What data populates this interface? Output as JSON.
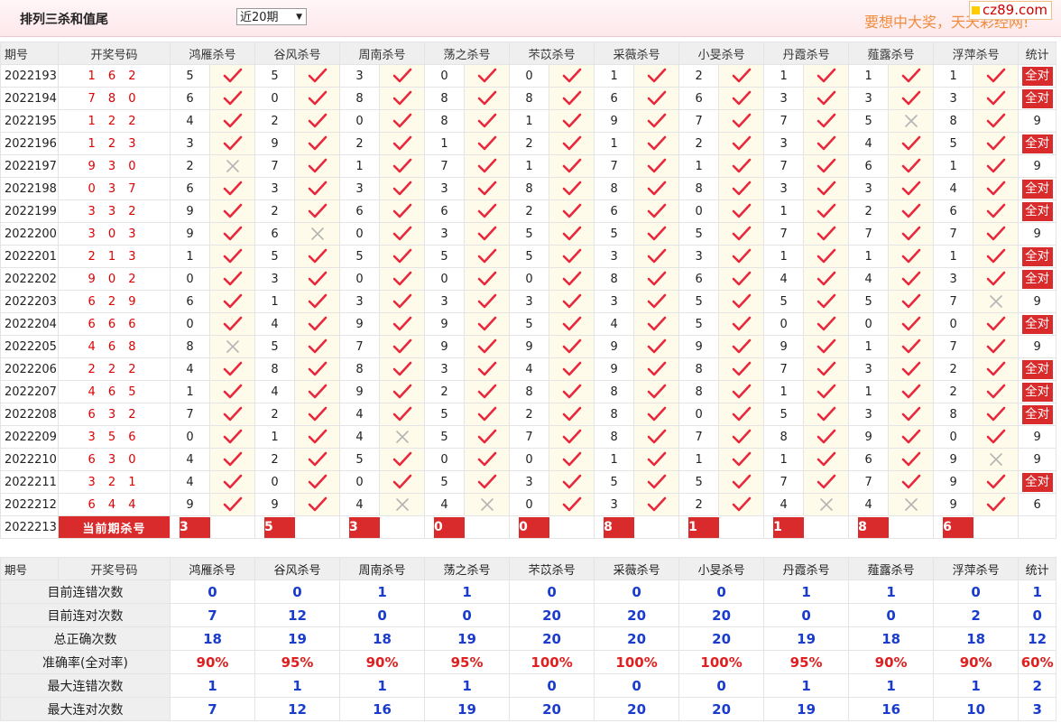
{
  "header": {
    "title": "排列三杀和值尾",
    "period_select": "近20期",
    "slogan": "要想中大奖，天天彩经网!",
    "logo": "cz89.com"
  },
  "columns": [
    "期号",
    "开奖号码",
    "鸿雁杀号",
    "谷风杀号",
    "周南杀号",
    "荡之杀号",
    "芣苡杀号",
    "采薇杀号",
    "小旻杀号",
    "丹霞杀号",
    "薤露杀号",
    "浮萍杀号",
    "统计"
  ],
  "all_correct_label": "全对",
  "rows": [
    {
      "id": "2022193",
      "draw": "1 6 2",
      "kills": [
        [
          5,
          1
        ],
        [
          5,
          1
        ],
        [
          3,
          1
        ],
        [
          0,
          1
        ],
        [
          0,
          1
        ],
        [
          1,
          1
        ],
        [
          2,
          1
        ],
        [
          1,
          1
        ],
        [
          1,
          1
        ],
        [
          1,
          1
        ]
      ],
      "stat": "全对"
    },
    {
      "id": "2022194",
      "draw": "7 8 0",
      "kills": [
        [
          6,
          1
        ],
        [
          0,
          1
        ],
        [
          8,
          1
        ],
        [
          8,
          1
        ],
        [
          8,
          1
        ],
        [
          6,
          1
        ],
        [
          6,
          1
        ],
        [
          3,
          1
        ],
        [
          3,
          1
        ],
        [
          3,
          1
        ]
      ],
      "stat": "全对"
    },
    {
      "id": "2022195",
      "draw": "1 2 2",
      "kills": [
        [
          4,
          1
        ],
        [
          2,
          1
        ],
        [
          0,
          1
        ],
        [
          8,
          1
        ],
        [
          1,
          1
        ],
        [
          9,
          1
        ],
        [
          7,
          1
        ],
        [
          7,
          1
        ],
        [
          5,
          0
        ],
        [
          8,
          1
        ]
      ],
      "stat": "9"
    },
    {
      "id": "2022196",
      "draw": "1 2 3",
      "kills": [
        [
          3,
          1
        ],
        [
          9,
          1
        ],
        [
          2,
          1
        ],
        [
          1,
          1
        ],
        [
          2,
          1
        ],
        [
          1,
          1
        ],
        [
          2,
          1
        ],
        [
          3,
          1
        ],
        [
          4,
          1
        ],
        [
          5,
          1
        ]
      ],
      "stat": "全对"
    },
    {
      "id": "2022197",
      "draw": "9 3 0",
      "kills": [
        [
          2,
          0
        ],
        [
          7,
          1
        ],
        [
          1,
          1
        ],
        [
          7,
          1
        ],
        [
          1,
          1
        ],
        [
          7,
          1
        ],
        [
          1,
          1
        ],
        [
          7,
          1
        ],
        [
          6,
          1
        ],
        [
          1,
          1
        ]
      ],
      "stat": "9"
    },
    {
      "id": "2022198",
      "draw": "0 3 7",
      "kills": [
        [
          6,
          1
        ],
        [
          3,
          1
        ],
        [
          3,
          1
        ],
        [
          3,
          1
        ],
        [
          8,
          1
        ],
        [
          8,
          1
        ],
        [
          8,
          1
        ],
        [
          3,
          1
        ],
        [
          3,
          1
        ],
        [
          4,
          1
        ]
      ],
      "stat": "全对"
    },
    {
      "id": "2022199",
      "draw": "3 3 2",
      "kills": [
        [
          9,
          1
        ],
        [
          2,
          1
        ],
        [
          6,
          1
        ],
        [
          6,
          1
        ],
        [
          2,
          1
        ],
        [
          6,
          1
        ],
        [
          0,
          1
        ],
        [
          1,
          1
        ],
        [
          2,
          1
        ],
        [
          6,
          1
        ]
      ],
      "stat": "全对"
    },
    {
      "id": "2022200",
      "draw": "3 0 3",
      "kills": [
        [
          9,
          1
        ],
        [
          6,
          0
        ],
        [
          0,
          1
        ],
        [
          3,
          1
        ],
        [
          5,
          1
        ],
        [
          5,
          1
        ],
        [
          5,
          1
        ],
        [
          7,
          1
        ],
        [
          7,
          1
        ],
        [
          7,
          1
        ]
      ],
      "stat": "9"
    },
    {
      "id": "2022201",
      "draw": "2 1 3",
      "kills": [
        [
          1,
          1
        ],
        [
          5,
          1
        ],
        [
          5,
          1
        ],
        [
          5,
          1
        ],
        [
          5,
          1
        ],
        [
          3,
          1
        ],
        [
          3,
          1
        ],
        [
          1,
          1
        ],
        [
          1,
          1
        ],
        [
          1,
          1
        ]
      ],
      "stat": "全对"
    },
    {
      "id": "2022202",
      "draw": "9 0 2",
      "kills": [
        [
          0,
          1
        ],
        [
          3,
          1
        ],
        [
          0,
          1
        ],
        [
          0,
          1
        ],
        [
          0,
          1
        ],
        [
          8,
          1
        ],
        [
          6,
          1
        ],
        [
          4,
          1
        ],
        [
          4,
          1
        ],
        [
          3,
          1
        ]
      ],
      "stat": "全对"
    },
    {
      "id": "2022203",
      "draw": "6 2 9",
      "kills": [
        [
          6,
          1
        ],
        [
          1,
          1
        ],
        [
          3,
          1
        ],
        [
          3,
          1
        ],
        [
          3,
          1
        ],
        [
          3,
          1
        ],
        [
          5,
          1
        ],
        [
          5,
          1
        ],
        [
          5,
          1
        ],
        [
          7,
          0
        ]
      ],
      "stat": "9"
    },
    {
      "id": "2022204",
      "draw": "6 6 6",
      "kills": [
        [
          0,
          1
        ],
        [
          4,
          1
        ],
        [
          9,
          1
        ],
        [
          9,
          1
        ],
        [
          5,
          1
        ],
        [
          4,
          1
        ],
        [
          5,
          1
        ],
        [
          0,
          1
        ],
        [
          0,
          1
        ],
        [
          0,
          1
        ]
      ],
      "stat": "全对"
    },
    {
      "id": "2022205",
      "draw": "4 6 8",
      "kills": [
        [
          8,
          0
        ],
        [
          5,
          1
        ],
        [
          7,
          1
        ],
        [
          9,
          1
        ],
        [
          9,
          1
        ],
        [
          9,
          1
        ],
        [
          9,
          1
        ],
        [
          9,
          1
        ],
        [
          1,
          1
        ],
        [
          7,
          1
        ]
      ],
      "stat": "9"
    },
    {
      "id": "2022206",
      "draw": "2 2 2",
      "kills": [
        [
          4,
          1
        ],
        [
          8,
          1
        ],
        [
          8,
          1
        ],
        [
          3,
          1
        ],
        [
          4,
          1
        ],
        [
          9,
          1
        ],
        [
          8,
          1
        ],
        [
          7,
          1
        ],
        [
          3,
          1
        ],
        [
          2,
          1
        ]
      ],
      "stat": "全对"
    },
    {
      "id": "2022207",
      "draw": "4 6 5",
      "kills": [
        [
          1,
          1
        ],
        [
          4,
          1
        ],
        [
          9,
          1
        ],
        [
          2,
          1
        ],
        [
          8,
          1
        ],
        [
          8,
          1
        ],
        [
          8,
          1
        ],
        [
          1,
          1
        ],
        [
          1,
          1
        ],
        [
          2,
          1
        ]
      ],
      "stat": "全对"
    },
    {
      "id": "2022208",
      "draw": "6 3 2",
      "kills": [
        [
          7,
          1
        ],
        [
          2,
          1
        ],
        [
          4,
          1
        ],
        [
          5,
          1
        ],
        [
          2,
          1
        ],
        [
          8,
          1
        ],
        [
          0,
          1
        ],
        [
          5,
          1
        ],
        [
          3,
          1
        ],
        [
          8,
          1
        ]
      ],
      "stat": "全对"
    },
    {
      "id": "2022209",
      "draw": "3 5 6",
      "kills": [
        [
          0,
          1
        ],
        [
          1,
          1
        ],
        [
          4,
          0
        ],
        [
          5,
          1
        ],
        [
          7,
          1
        ],
        [
          8,
          1
        ],
        [
          7,
          1
        ],
        [
          8,
          1
        ],
        [
          9,
          1
        ],
        [
          0,
          1
        ]
      ],
      "stat": "9"
    },
    {
      "id": "2022210",
      "draw": "6 3 0",
      "kills": [
        [
          4,
          1
        ],
        [
          2,
          1
        ],
        [
          5,
          1
        ],
        [
          0,
          1
        ],
        [
          0,
          1
        ],
        [
          1,
          1
        ],
        [
          1,
          1
        ],
        [
          1,
          1
        ],
        [
          6,
          1
        ],
        [
          9,
          0
        ]
      ],
      "stat": "9"
    },
    {
      "id": "2022211",
      "draw": "3 2 1",
      "kills": [
        [
          4,
          1
        ],
        [
          0,
          1
        ],
        [
          0,
          1
        ],
        [
          5,
          1
        ],
        [
          3,
          1
        ],
        [
          5,
          1
        ],
        [
          5,
          1
        ],
        [
          7,
          1
        ],
        [
          7,
          1
        ],
        [
          9,
          1
        ]
      ],
      "stat": "全对"
    },
    {
      "id": "2022212",
      "draw": "6 4 4",
      "kills": [
        [
          9,
          1
        ],
        [
          9,
          1
        ],
        [
          4,
          0
        ],
        [
          4,
          0
        ],
        [
          0,
          1
        ],
        [
          3,
          1
        ],
        [
          2,
          1
        ],
        [
          4,
          0
        ],
        [
          4,
          0
        ],
        [
          9,
          1
        ]
      ],
      "stat": "6"
    }
  ],
  "current": {
    "id": "2022213",
    "label": "当前期杀号",
    "kills": [
      "3",
      "5",
      "3",
      "0",
      "0",
      "8",
      "1",
      "1",
      "8",
      "6"
    ]
  },
  "stats": [
    {
      "label": "目前连错次数",
      "values": [
        "0",
        "0",
        "1",
        "1",
        "0",
        "0",
        "0",
        "1",
        "1",
        "0",
        "1"
      ]
    },
    {
      "label": "目前连对次数",
      "values": [
        "7",
        "12",
        "0",
        "0",
        "20",
        "20",
        "20",
        "0",
        "0",
        "2",
        "0"
      ]
    },
    {
      "label": "总正确次数",
      "values": [
        "18",
        "19",
        "18",
        "19",
        "20",
        "20",
        "20",
        "19",
        "18",
        "18",
        "12"
      ]
    },
    {
      "label": "准确率(全对率)",
      "values": [
        "90%",
        "95%",
        "90%",
        "95%",
        "100%",
        "100%",
        "100%",
        "95%",
        "90%",
        "90%",
        "60%"
      ],
      "red": true
    },
    {
      "label": "最大连错次数",
      "values": [
        "1",
        "1",
        "1",
        "1",
        "0",
        "0",
        "0",
        "1",
        "1",
        "1",
        "2"
      ]
    },
    {
      "label": "最大连对次数",
      "values": [
        "7",
        "12",
        "16",
        "19",
        "20",
        "20",
        "20",
        "19",
        "16",
        "10",
        "3"
      ]
    }
  ]
}
